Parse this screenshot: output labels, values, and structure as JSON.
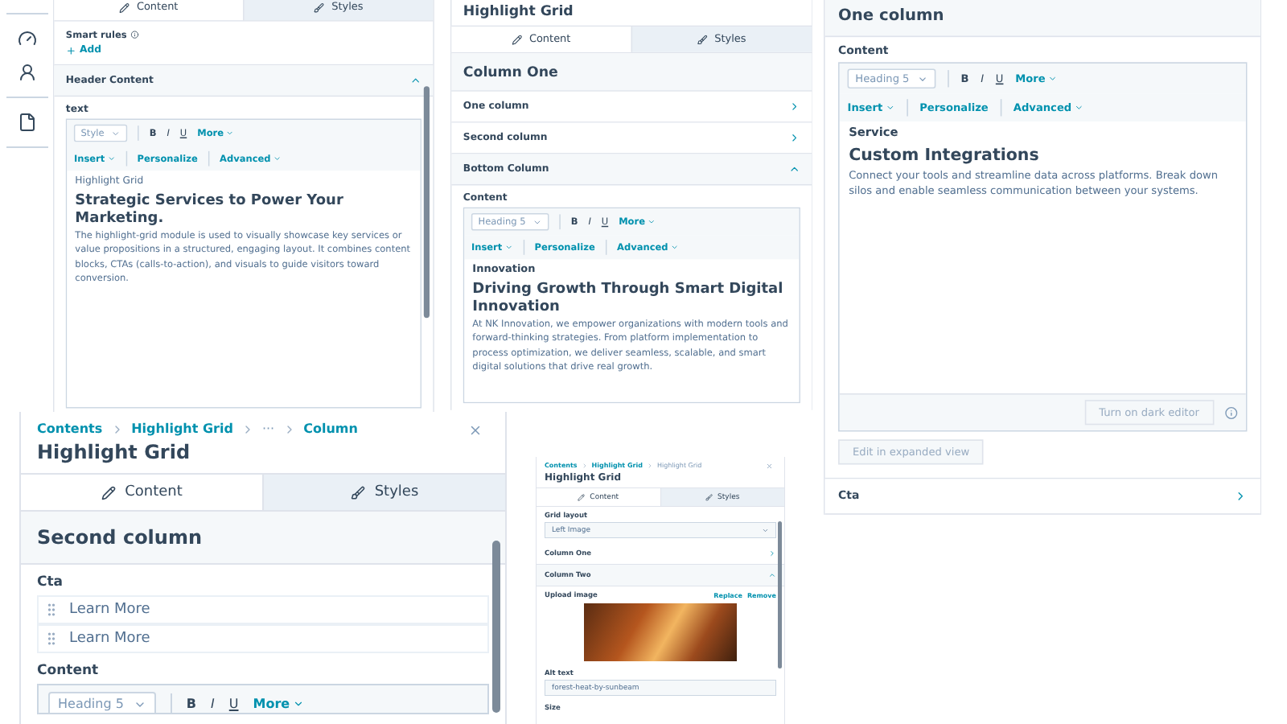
{
  "panels": [
    {
      "kind": "rail",
      "blocks": [
        {
          "kind": "tabs",
          "tabs": [
            {
              "label": "Content",
              "selected": true
            },
            {
              "label": "Styles",
              "selected": false
            }
          ]
        },
        {
          "kind": "smart_rules",
          "label": "Smart rules",
          "action": "Add"
        },
        {
          "kind": "accordion",
          "label": "Header Content",
          "expanded": true
        },
        {
          "kind": "label",
          "text": "text"
        },
        {
          "kind": "editor",
          "style": "Style",
          "formats": [
            {
              "kind": "bold",
              "label": "B"
            },
            {
              "kind": "italic",
              "label": "I"
            },
            {
              "kind": "underline",
              "label": "U"
            }
          ],
          "more": "More",
          "insert": "Insert",
          "personalize": "Personalize",
          "advanced": "Advanced",
          "body": [
            {
              "kind": "small",
              "text": "Highlight Grid"
            },
            {
              "kind": "heading",
              "text": "Strategic Services to Power Your Marketing."
            },
            {
              "kind": "paragraph",
              "text": "The highlight-grid module is used to visually showcase key services or value propositions in a structured, engaging layout. It combines content blocks, CTAs (calls-to-action), and visuals to guide visitors toward conversion."
            }
          ]
        }
      ]
    },
    {
      "kind": "plain",
      "blocks": [
        {
          "kind": "title",
          "text": "Highlight Grid"
        },
        {
          "kind": "tabs",
          "tabs": [
            {
              "label": "Content",
              "selected": true
            },
            {
              "label": "Styles",
              "selected": false
            }
          ]
        },
        {
          "kind": "heading",
          "text": "Column One"
        },
        {
          "kind": "accordion",
          "label": "One column",
          "expanded": false
        },
        {
          "kind": "accordion",
          "label": "Second column",
          "expanded": false
        },
        {
          "kind": "accordion",
          "label": "Bottom Column",
          "expanded": true
        },
        {
          "kind": "label",
          "text": "Content"
        },
        {
          "kind": "editor",
          "style": "Heading 5",
          "formats": [
            {
              "kind": "bold",
              "label": "B"
            },
            {
              "kind": "italic",
              "label": "I"
            },
            {
              "kind": "underline",
              "label": "U"
            }
          ],
          "more": "More",
          "insert": "Insert",
          "personalize": "Personalize",
          "advanced": "Advanced",
          "body": [
            {
              "kind": "eyebrow",
              "text": "Innovation"
            },
            {
              "kind": "heading",
              "text": "Driving Growth Through Smart Digital Innovation"
            },
            {
              "kind": "paragraph",
              "text": "At NK Innovation, we empower organizations with modern tools and forward-thinking strategies. From platform implementation to process optimization, we deliver seamless, scalable, and smart digital solutions that drive real growth."
            }
          ]
        }
      ]
    },
    {
      "kind": "plain",
      "blocks": [
        {
          "kind": "heading",
          "text": "One column"
        },
        {
          "kind": "label",
          "text": "Content"
        },
        {
          "kind": "editor",
          "style": "Heading 5",
          "formats": [
            {
              "kind": "bold",
              "label": "B"
            },
            {
              "kind": "italic",
              "label": "I"
            },
            {
              "kind": "underline",
              "label": "U"
            }
          ],
          "more": "More",
          "insert": "Insert",
          "personalize": "Personalize",
          "advanced": "Advanced",
          "dark_editor": "Turn on dark editor",
          "body": [
            {
              "kind": "eyebrow",
              "text": "Service"
            },
            {
              "kind": "heading",
              "text": "Custom Integrations"
            },
            {
              "kind": "paragraph",
              "text": "Connect your tools and streamline data across platforms. Break down silos and enable seamless communication between your systems."
            }
          ]
        },
        {
          "kind": "button",
          "label": "Edit in expanded view"
        },
        {
          "kind": "accordion",
          "label": "Cta",
          "expanded": false
        }
      ]
    },
    {
      "kind": "plain",
      "blocks": [
        {
          "kind": "breadcrumb",
          "items": [
            {
              "label": "Contents",
              "link": true
            },
            {
              "label": "Highlight Grid",
              "link": true
            },
            {
              "label": "···",
              "link": false
            },
            {
              "label": "Column",
              "link": true
            }
          ]
        },
        {
          "kind": "title",
          "text": "Highlight Grid"
        },
        {
          "kind": "tabs",
          "tabs": [
            {
              "label": "Content",
              "selected": true
            },
            {
              "label": "Styles",
              "selected": false
            }
          ]
        },
        {
          "kind": "heading",
          "text": "Second column"
        },
        {
          "kind": "label",
          "text": "Cta"
        },
        {
          "kind": "cta_list",
          "items": [
            "Learn More",
            "Learn More"
          ]
        },
        {
          "kind": "label",
          "text": "Content"
        },
        {
          "kind": "editor",
          "style": "Heading 5",
          "formats": [
            {
              "kind": "bold",
              "label": "B"
            },
            {
              "kind": "italic",
              "label": "I"
            },
            {
              "kind": "underline",
              "label": "U"
            }
          ],
          "more": "More"
        }
      ]
    },
    {
      "kind": "plain",
      "blocks": [
        {
          "kind": "breadcrumb",
          "items": [
            {
              "label": "Contents",
              "link": true
            },
            {
              "label": "Highlight Grid",
              "link": true
            },
            {
              "label": "Highlight Grid",
              "link": false
            }
          ]
        },
        {
          "kind": "title",
          "text": "Highlight Grid"
        },
        {
          "kind": "tabs",
          "tabs": [
            {
              "label": "Content",
              "selected": true
            },
            {
              "label": "Styles",
              "selected": false
            }
          ]
        },
        {
          "kind": "label",
          "text": "Grid layout"
        },
        {
          "kind": "select",
          "value": "Left Image"
        },
        {
          "kind": "accordion",
          "label": "Column One",
          "expanded": false
        },
        {
          "kind": "accordion",
          "label": "Column Two",
          "expanded": true
        },
        {
          "kind": "upload",
          "label": "Upload image",
          "actions": [
            "Replace",
            "Remove"
          ]
        },
        {
          "kind": "label",
          "text": "Alt text"
        },
        {
          "kind": "input",
          "value": "forest-heat-by-sunbeam"
        },
        {
          "kind": "label",
          "text": "Size"
        }
      ]
    }
  ]
}
